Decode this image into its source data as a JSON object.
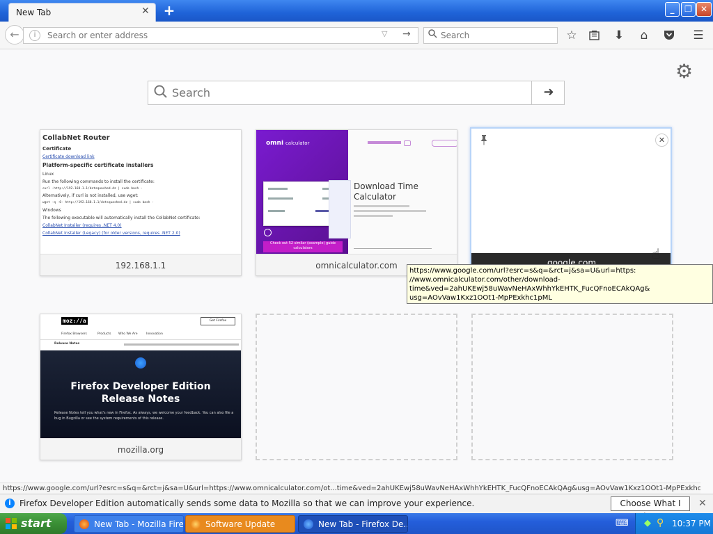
{
  "browser": {
    "tab_title": "New Tab",
    "new_tab_symbol": "+",
    "window_buttons": {
      "minimize": "_",
      "maximize": "❐",
      "close": "✕"
    }
  },
  "navbar": {
    "url_placeholder": "Search or enter address",
    "search_placeholder": "Search",
    "info_symbol": "i"
  },
  "content": {
    "search_placeholder": "Search"
  },
  "tiles": [
    {
      "label": "192.168.1.1",
      "thumb": {
        "title": "CollabNet Router",
        "section1": "Certificate",
        "link1": "Certificate download link",
        "section2": "Platform-specific certificate installers",
        "subsection1": "Linux",
        "line1": "Run the following commands to install the certificate:",
        "line2": "curl -http://192.168.1.1/dotsquashed.dz | sudo bash -",
        "line3": "Alternatively, if curl is not installed, use wget:",
        "line4": "wget -q -O- http://192.168.1.1/dotsquashed.dz | sudo bash -",
        "subsection2": "Windows",
        "line5": "The following executable will automatically install the CollabNet certificate:",
        "link2": "CollabNet Installer (requires .NET 4.0)",
        "link3": "CollabNet Installer (Legacy) (for older versions, requires .NET 2.0)"
      }
    },
    {
      "label": "omnicalculator.com",
      "thumb": {
        "brand": "omni",
        "brand_sub": "calculator",
        "heading": "Download Time Calculator",
        "cta": "Check out 52 similar (example) guide calculators"
      }
    },
    {
      "label": "google.com",
      "pin_symbol": "📌",
      "close_symbol": "✕"
    },
    {
      "label": "mozilla.org",
      "thumb": {
        "brand": "moz://a",
        "nav": [
          "Firefox Browsers",
          "Products",
          "Who We Are",
          "Innovation"
        ],
        "button": "Get Firefox",
        "subnav_title": "Release Notes",
        "hero_title_1": "Firefox Developer Edition",
        "hero_title_2": "Release Notes",
        "hero_text": "Release Notes tell you what's new in Firefox. As always, we welcome your feedback. You can also file a bug in Bugzilla or see the system requirements of this release."
      }
    }
  ],
  "tooltip": {
    "lines": [
      "https://www.google.com/url?esrc=s&q=&rct=j&sa=U&url=https:",
      "//www.omnicalculator.com/other/download-",
      "time&ved=2ahUKEwj58uWavNeHAxWhhYkEHTK_FucQFnoECAkQAg&",
      "usg=AOvVaw1Kxz1OOt1-MpPExkhc1pML"
    ]
  },
  "status_url": "https://www.google.com/url?esrc=s&q=&rct=j&sa=U&url=https://www.omnicalculator.com/ot...time&ved=2ahUKEwj58uWavNeHAxWhhYkEHTK_FucQFnoECAkQAg&usg=AOvVaw1Kxz1OOt1-MpPExkhc1pML",
  "notification": {
    "text": "Firefox Developer Edition automatically sends some data to Mozilla so that we can improve your experience.",
    "button": "Choose What I Share"
  },
  "taskbar": {
    "start_label": "start",
    "tasks": [
      {
        "label": "New Tab - Mozilla Fire...",
        "active": false
      },
      {
        "label": "Software Update",
        "active": false
      },
      {
        "label": "New Tab - Firefox De...",
        "active": true
      }
    ],
    "clock": "10:37 PM"
  }
}
